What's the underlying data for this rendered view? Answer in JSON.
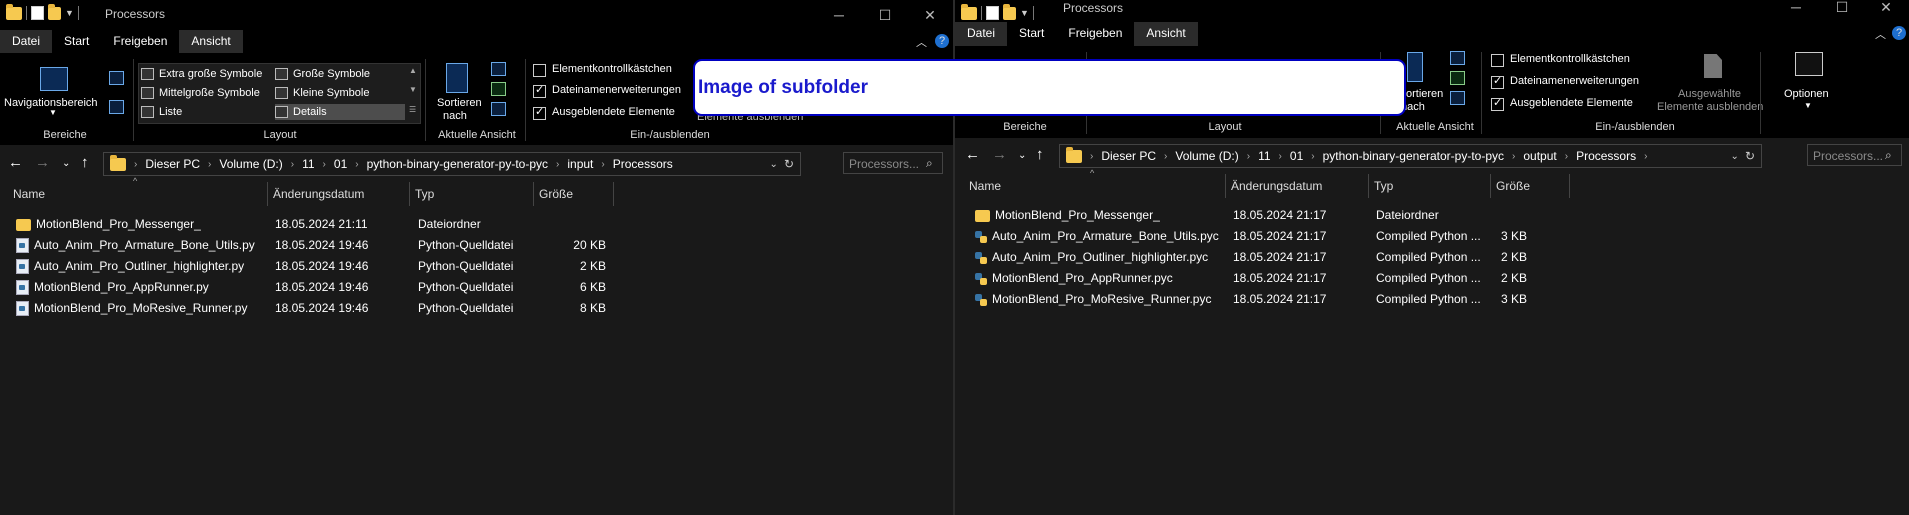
{
  "left": {
    "title": "Processors",
    "tabs": [
      "Datei",
      "Start",
      "Freigeben",
      "Ansicht"
    ],
    "ribbon": {
      "nav_pane_label": "Navigationsbereich",
      "layout_items": [
        "Extra große Symbole",
        "Große Symbole",
        "Mittelgroße Symbole",
        "Kleine Symbole",
        "Liste",
        "Details"
      ],
      "sort_label_1": "Sortieren",
      "sort_label_2": "nach",
      "checkboxes": [
        "Elementkontrollkästchen",
        "Dateinamenerweiterungen",
        "Ausgeblendete Elemente"
      ],
      "partial_hide_label": "Elemente ausblenden",
      "groups": [
        "Bereiche",
        "Layout",
        "Aktuelle Ansicht",
        "Ein-/ausblenden"
      ]
    },
    "address": [
      "Dieser PC",
      "Volume (D:)",
      "11",
      "01",
      "python-binary-generator-py-to-pyc",
      "input",
      "Processors"
    ],
    "search_placeholder": "Processors...",
    "columns": [
      "Name",
      "Änderungsdatum",
      "Typ",
      "Größe"
    ],
    "files": [
      {
        "name": "MotionBlend_Pro_Messenger_",
        "date": "18.05.2024 21:11",
        "type": "Dateiordner",
        "size": "",
        "icon": "folder-icon"
      },
      {
        "name": "Auto_Anim_Pro_Armature_Bone_Utils.py",
        "date": "18.05.2024 19:46",
        "type": "Python-Quelldatei",
        "size": "20 KB",
        "icon": "python-file-icon"
      },
      {
        "name": "Auto_Anim_Pro_Outliner_highlighter.py",
        "date": "18.05.2024 19:46",
        "type": "Python-Quelldatei",
        "size": "2 KB",
        "icon": "python-file-icon"
      },
      {
        "name": "MotionBlend_Pro_AppRunner.py",
        "date": "18.05.2024 19:46",
        "type": "Python-Quelldatei",
        "size": "6 KB",
        "icon": "python-file-icon"
      },
      {
        "name": "MotionBlend_Pro_MoResive_Runner.py",
        "date": "18.05.2024 19:46",
        "type": "Python-Quelldatei",
        "size": "8 KB",
        "icon": "python-file-icon"
      }
    ]
  },
  "right": {
    "title": "Processors",
    "tabs": [
      "Datei",
      "Start",
      "Freigeben",
      "Ansicht"
    ],
    "ribbon": {
      "sort_label_1": "ortieren",
      "sort_label_2": "nach",
      "checkboxes": [
        "Elementkontrollkästchen",
        "Dateinamenerweiterungen",
        "Ausgeblendete Elemente"
      ],
      "hide_selected_1": "Ausgewählte",
      "hide_selected_2": "Elemente ausblenden",
      "options_label": "Optionen",
      "groups": [
        "Bereiche",
        "Layout",
        "Aktuelle Ansicht",
        "Ein-/ausblenden"
      ]
    },
    "address": [
      "Dieser PC",
      "Volume (D:)",
      "11",
      "01",
      "python-binary-generator-py-to-pyc",
      "output",
      "Processors"
    ],
    "search_placeholder": "Processors...",
    "columns": [
      "Name",
      "Änderungsdatum",
      "Typ",
      "Größe"
    ],
    "files": [
      {
        "name": "MotionBlend_Pro_Messenger_",
        "date": "18.05.2024 21:17",
        "type": "Dateiordner",
        "size": "",
        "icon": "folder-icon"
      },
      {
        "name": "Auto_Anim_Pro_Armature_Bone_Utils.pyc",
        "date": "18.05.2024 21:17",
        "type": "Compiled Python ...",
        "size": "3 KB",
        "icon": "compiled-python-icon"
      },
      {
        "name": "Auto_Anim_Pro_Outliner_highlighter.pyc",
        "date": "18.05.2024 21:17",
        "type": "Compiled Python ...",
        "size": "2 KB",
        "icon": "compiled-python-icon"
      },
      {
        "name": "MotionBlend_Pro_AppRunner.pyc",
        "date": "18.05.2024 21:17",
        "type": "Compiled Python ...",
        "size": "2 KB",
        "icon": "compiled-python-icon"
      },
      {
        "name": "MotionBlend_Pro_MoResive_Runner.pyc",
        "date": "18.05.2024 21:17",
        "type": "Compiled Python ...",
        "size": "3 KB",
        "icon": "compiled-python-icon"
      }
    ]
  },
  "callout_text": "Image of subfolder"
}
